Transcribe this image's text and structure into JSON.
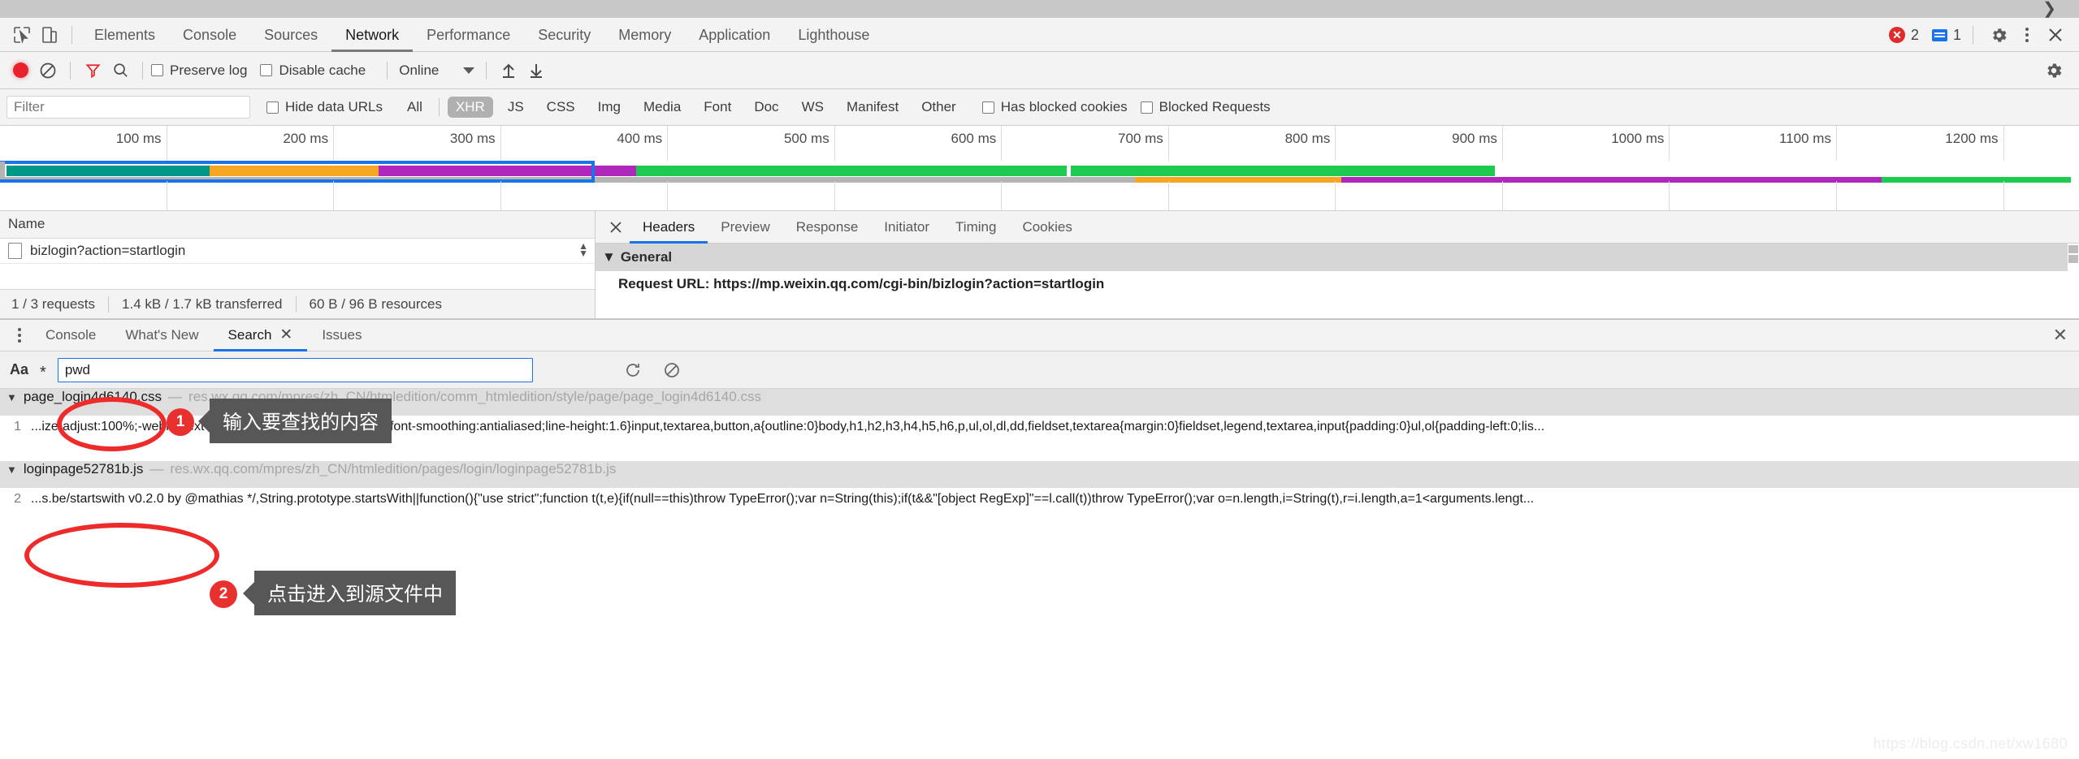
{
  "browser": {
    "expand_icon": "chevron-right-icon"
  },
  "devtools": {
    "inspect_icon": "inspect-element-icon",
    "device_icon": "device-toolbar-icon",
    "tabs": [
      {
        "label": "Elements",
        "active": false
      },
      {
        "label": "Console",
        "active": false
      },
      {
        "label": "Sources",
        "active": false
      },
      {
        "label": "Network",
        "active": true
      },
      {
        "label": "Performance",
        "active": false
      },
      {
        "label": "Security",
        "active": false
      },
      {
        "label": "Memory",
        "active": false
      },
      {
        "label": "Application",
        "active": false
      },
      {
        "label": "Lighthouse",
        "active": false
      }
    ],
    "status": {
      "error_icon": "error-circle-icon",
      "error_count": "2",
      "message_icon": "message-square-icon",
      "message_count": "1"
    },
    "settings_icon": "gear-icon",
    "more_icon": "kebab-menu-icon",
    "close_icon": "close-icon"
  },
  "network_toolbar": {
    "record_icon": "record-circle-icon",
    "clear_icon": "clear-no-entry-icon",
    "filter_icon": "filter-funnel-icon",
    "search_icon": "search-magnifier-icon",
    "preserve_log_label": "Preserve log",
    "preserve_log_checked": false,
    "disable_cache_label": "Disable cache",
    "disable_cache_checked": false,
    "throttling_value": "Online",
    "throttling_caret": "chevron-down-icon",
    "import_icon": "import-har-arrow-up-icon",
    "export_icon": "export-har-arrow-down-icon",
    "settings_icon": "gear-icon"
  },
  "filter_row": {
    "filter_placeholder": "Filter",
    "filter_value": "",
    "hide_data_urls_label": "Hide data URLs",
    "hide_data_urls_checked": false,
    "types": [
      {
        "label": "All",
        "active": false
      },
      {
        "label": "XHR",
        "active": true
      },
      {
        "label": "JS",
        "active": false
      },
      {
        "label": "CSS",
        "active": false
      },
      {
        "label": "Img",
        "active": false
      },
      {
        "label": "Media",
        "active": false
      },
      {
        "label": "Font",
        "active": false
      },
      {
        "label": "Doc",
        "active": false
      },
      {
        "label": "WS",
        "active": false
      },
      {
        "label": "Manifest",
        "active": false
      },
      {
        "label": "Other",
        "active": false
      }
    ],
    "has_blocked_cookies_label": "Has blocked cookies",
    "has_blocked_cookies_checked": false,
    "blocked_requests_label": "Blocked Requests",
    "blocked_requests_checked": false
  },
  "overview": {
    "ticks": [
      "100 ms",
      "200 ms",
      "300 ms",
      "400 ms",
      "500 ms",
      "600 ms",
      "700 ms",
      "800 ms",
      "900 ms",
      "1000 ms",
      "1100 ms",
      "1200 ms"
    ],
    "colors": {
      "teal": "#009688",
      "orange": "#f5a623",
      "purple": "#b028bb",
      "green": "#1ecb4f",
      "grey": "#b4b4b4",
      "selection": "#1a73e8"
    },
    "bars": [
      {
        "track": 1,
        "start_pct": 0.3,
        "end_pct": 10.1,
        "color": "#009688"
      },
      {
        "track": 1,
        "start_pct": 10.1,
        "end_pct": 18.2,
        "color": "#f5a623"
      },
      {
        "track": 1,
        "start_pct": 18.2,
        "end_pct": 30.6,
        "color": "#b028bb"
      },
      {
        "track": 1,
        "start_pct": 30.6,
        "end_pct": 51.3,
        "color": "#1ecb4f"
      },
      {
        "track": 1,
        "start_pct": 51.5,
        "end_pct": 71.9,
        "color": "#1ecb4f"
      },
      {
        "track": 2,
        "start_pct": 0.1,
        "end_pct": 54.6,
        "color": "#b4b4b4"
      },
      {
        "track": 2,
        "start_pct": 54.6,
        "end_pct": 64.5,
        "color": "#f5a623"
      },
      {
        "track": 2,
        "start_pct": 64.5,
        "end_pct": 90.5,
        "color": "#b028bb"
      },
      {
        "track": 2,
        "start_pct": 90.5,
        "end_pct": 99.6,
        "color": "#1ecb4f"
      }
    ],
    "selection": {
      "start_pct": 0.0,
      "end_pct": 28.6
    }
  },
  "request_list": {
    "column_header": "Name",
    "rows": [
      {
        "name": "bizlogin?action=startlogin"
      }
    ],
    "scroll_icon": "sort-arrows-icon",
    "summary": {
      "requests": "1 / 3 requests",
      "transferred": "1.4 kB / 1.7 kB transferred",
      "resources": "60 B / 96 B resources"
    }
  },
  "detail_panel": {
    "close_icon": "close-icon",
    "tabs": [
      {
        "label": "Headers",
        "active": true
      },
      {
        "label": "Preview",
        "active": false
      },
      {
        "label": "Response",
        "active": false
      },
      {
        "label": "Initiator",
        "active": false
      },
      {
        "label": "Timing",
        "active": false
      },
      {
        "label": "Cookies",
        "active": false
      }
    ],
    "section_caret": "triangle-down-icon",
    "section_title": "General",
    "first_row": "Request URL: https://mp.weixin.qq.com/cgi-bin/bizlogin?action=startlogin"
  },
  "drawer": {
    "menu_icon": "kebab-menu-icon",
    "tabs": [
      {
        "label": "Console",
        "active": false,
        "closable": false
      },
      {
        "label": "What's New",
        "active": false,
        "closable": false
      },
      {
        "label": "Search",
        "active": true,
        "closable": true
      },
      {
        "label": "Issues",
        "active": false,
        "closable": false
      }
    ],
    "tab_close_icon": "close-icon",
    "drawer_close_icon": "close-icon"
  },
  "search_panel": {
    "match_case_label": "Aa",
    "regex_label": "*",
    "query_value": "pwd",
    "query_placeholder": "",
    "refresh_icon": "refresh-icon",
    "clear_icon": "clear-no-entry-icon",
    "results": [
      {
        "caret": "triangle-down-icon",
        "file": "page_login4d6140.css",
        "dash": "—",
        "url": "res.wx.qq.com/mpres/zh_CN/htmledition/comm_htmledition/style/page/page_login4d6140.css",
        "line_number": "1",
        "code": "...ize-adjust:100%;-webkit-text-size-adjust:100%}body{-webkit-font-smoothing:antialiased;line-height:1.6}input,textarea,button,a{outline:0}body,h1,h2,h3,h4,h5,h6,p,ul,ol,dl,dd,fieldset,textarea{margin:0}fieldset,legend,textarea,input{padding:0}ul,ol{padding-left:0;lis..."
      },
      {
        "caret": "triangle-down-icon",
        "file": "loginpage52781b.js",
        "dash": "—",
        "url": "res.wx.qq.com/mpres/zh_CN/htmledition/pages/login/loginpage52781b.js",
        "line_number": "2",
        "code": "...s.be/startswith v0.2.0 by @mathias */,String.prototype.startsWith||function(){\"use strict\";function t(t,e){if(null==this)throw TypeError();var n=String(this);if(t&&\"[object RegExp]\"==l.call(t))throw TypeError();var o=n.length,i=String(t),r=i.length,a=1<arguments.lengt..."
      }
    ]
  },
  "annotations": [
    {
      "badge": "1",
      "tip": "输入要查找的内容"
    },
    {
      "badge": "2",
      "tip": "点击进入到源文件中"
    }
  ],
  "watermark": "https://blog.csdn.net/xw1680"
}
